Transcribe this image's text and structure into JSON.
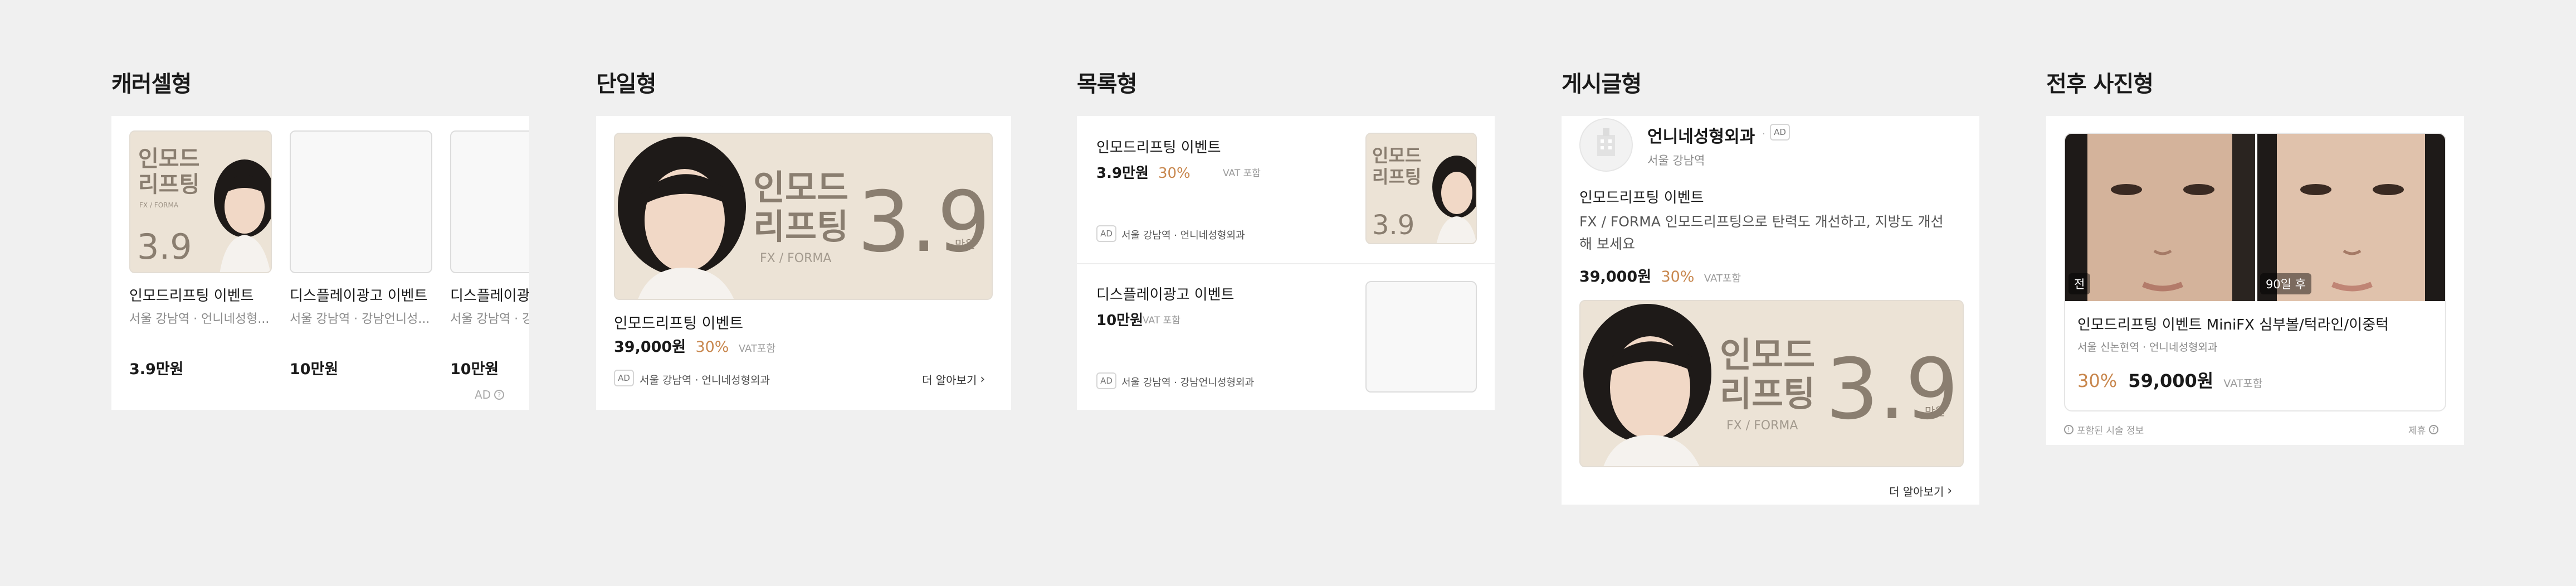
{
  "sections": {
    "carousel": {
      "title": "캐러셀형",
      "items": [
        {
          "title": "인모드리프팅 이벤트",
          "sub": "서울 강남역 · 언니네성형...",
          "price": "3.9만원"
        },
        {
          "title": "디스플레이광고 이벤트",
          "sub": "서울 강남역 · 강남언니성...",
          "price": "10만원"
        },
        {
          "title": "디스플레이광",
          "sub": "서울 강남역 · 강",
          "price": "10만원"
        }
      ],
      "ad_label": "AD"
    },
    "single": {
      "title": "단일형",
      "item_title": "인모드리프팅 이벤트",
      "price": "39,000원",
      "pct": "30%",
      "vat": "VAT포함",
      "ad": "AD",
      "location": "서울 강남역 · 언니네성형외과",
      "more": "더 알아보기"
    },
    "list": {
      "title": "목록형",
      "items": [
        {
          "title": "인모드리프팅 이벤트",
          "price": "3.9만원",
          "pct": "30%",
          "vat": "VAT 포함",
          "ad": "AD",
          "location": "서울 강남역 · 언니네성형외과"
        },
        {
          "title": "디스플레이광고 이벤트",
          "price": "10만원",
          "pct": "",
          "vat": "VAT 포함",
          "ad": "AD",
          "location": "서울 강남역 · 강남언니성형외과"
        }
      ]
    },
    "post": {
      "title": "게시글형",
      "clinic": "언니네성형외과",
      "ad": "AD",
      "location": "서울 강남역",
      "event_title": "인모드리프팅 이벤트",
      "body_line1": "FX / FORMA 인모드리프팅으로 탄력도 개선하고, 지방도 개선",
      "body_line2": "해 보세요",
      "price": "39,000원",
      "pct": "30%",
      "vat": "VAT포함",
      "more": "더 알아보기"
    },
    "before_after": {
      "title": "전후 사진형",
      "before_tag": "전",
      "after_tag": "90일 후",
      "item_title": "인모드리프팅 이벤트 MiniFX 심부볼/턱라인/이중턱",
      "location": "서울 신논현역 · 언니네성형외과",
      "pct": "30%",
      "price": "59,000원",
      "vat": "VAT포함",
      "footer_left": "포함된 시술 정보",
      "footer_right": "제휴"
    }
  },
  "banner": {
    "line1": "인모드",
    "line2": "리프팅",
    "sub": "FX / FORMA",
    "big": "3.9",
    "unit": "만원"
  },
  "colors": {
    "background": "#f0f0f0",
    "accent": "#c8874e",
    "banner_bg": "#ece3d6",
    "banner_text": "#8a7e70"
  }
}
